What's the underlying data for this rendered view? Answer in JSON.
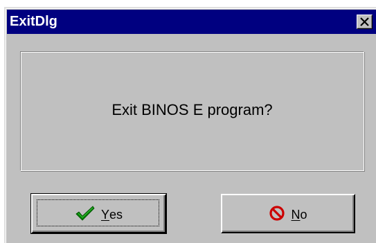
{
  "dialog": {
    "title": "ExitDlg",
    "message": "Exit BINOS E program?"
  },
  "buttons": {
    "yes": {
      "mnemonic": "Y",
      "rest": "es",
      "icon": "checkmark-icon",
      "icon_color": "#008000"
    },
    "no": {
      "mnemonic": "N",
      "rest": "o",
      "icon": "no-entry-icon",
      "icon_color": "#cc0000"
    }
  },
  "colors": {
    "titlebar": "#000080",
    "face": "#c0c0c0"
  }
}
